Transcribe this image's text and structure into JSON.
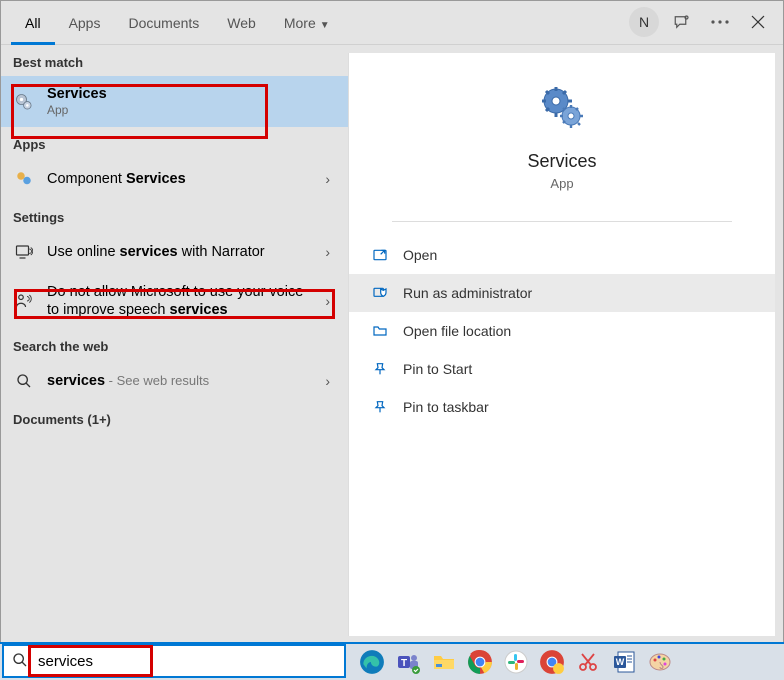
{
  "tabs": {
    "all": "All",
    "apps": "Apps",
    "documents": "Documents",
    "web": "Web",
    "more": "More"
  },
  "avatar_initial": "N",
  "sections": {
    "best_match": "Best match",
    "apps": "Apps",
    "settings": "Settings",
    "web": "Search the web",
    "documents": "Documents (1+)"
  },
  "best_match": {
    "title": "Services",
    "sub": "App"
  },
  "apps_result": {
    "prefix": "Component ",
    "bold": "Services"
  },
  "settings_results": [
    {
      "pre": "Use online ",
      "bold": "services",
      "post": " with Narrator"
    },
    {
      "pre": "Do not allow Microsoft to use your voice to improve speech ",
      "bold": "services",
      "post": ""
    }
  ],
  "web_result": {
    "bold": "services",
    "post": " - See web results"
  },
  "preview": {
    "title": "Services",
    "sub": "App"
  },
  "actions": {
    "open": "Open",
    "run_admin": "Run as administrator",
    "open_loc": "Open file location",
    "pin_start": "Pin to Start",
    "pin_taskbar": "Pin to taskbar"
  },
  "search_value": "services"
}
